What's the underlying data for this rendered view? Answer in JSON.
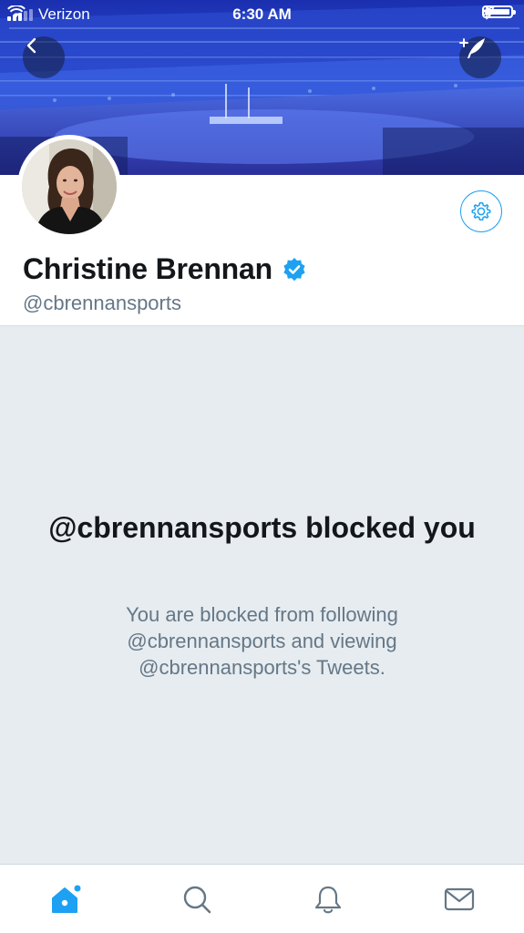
{
  "status_bar": {
    "carrier": "Verizon",
    "time": "6:30 AM",
    "signal_bars_filled": 3,
    "signal_bars_total": 5,
    "battery_level": 1.0
  },
  "header": {
    "back_icon": "chevron-left-icon",
    "compose_icon": "compose-tweet-icon"
  },
  "profile": {
    "display_name": "Christine Brennan",
    "handle": "@cbrennansports",
    "verified": true,
    "settings_icon": "gear-icon"
  },
  "blocked": {
    "title": "@cbrennansports blocked you",
    "message": "You are blocked from following @cbrennansports and viewing @cbrennansports's Tweets."
  },
  "tab_bar": {
    "items": [
      {
        "name": "home",
        "icon": "home-icon",
        "active": true,
        "has_badge": true
      },
      {
        "name": "search",
        "icon": "search-icon",
        "active": false
      },
      {
        "name": "notifications",
        "icon": "bell-icon",
        "active": false
      },
      {
        "name": "messages",
        "icon": "envelope-icon",
        "active": false
      }
    ]
  },
  "colors": {
    "accent": "#1da1f2",
    "blocked_background": "#e6ecf0",
    "primary_text": "#14171a",
    "secondary_text": "#657786",
    "tab_icon": "#657786",
    "active_tab_icon": "#1da1f2"
  }
}
